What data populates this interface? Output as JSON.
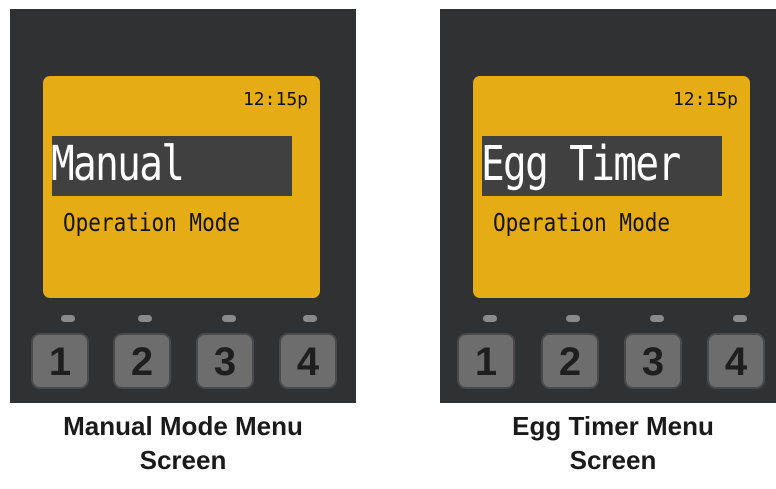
{
  "screens": [
    {
      "clock": "12:15p",
      "mode_name": "Manual",
      "subtitle": "Operation Mode",
      "buttons": [
        "1",
        "2",
        "3",
        "4"
      ],
      "caption_line1": "Manual Mode Menu",
      "caption_line2": "Screen"
    },
    {
      "clock": "12:15p",
      "mode_name": "Egg Timer",
      "subtitle": "Operation Mode",
      "buttons": [
        "1",
        "2",
        "3",
        "4"
      ],
      "caption_line1": "Egg Timer Menu",
      "caption_line2": "Screen"
    }
  ],
  "colors": {
    "panel": "#303133",
    "lcd": "#e6ac14",
    "highlight": "#404040",
    "button": "#6d6d6d",
    "led": "#8a8a8a"
  }
}
